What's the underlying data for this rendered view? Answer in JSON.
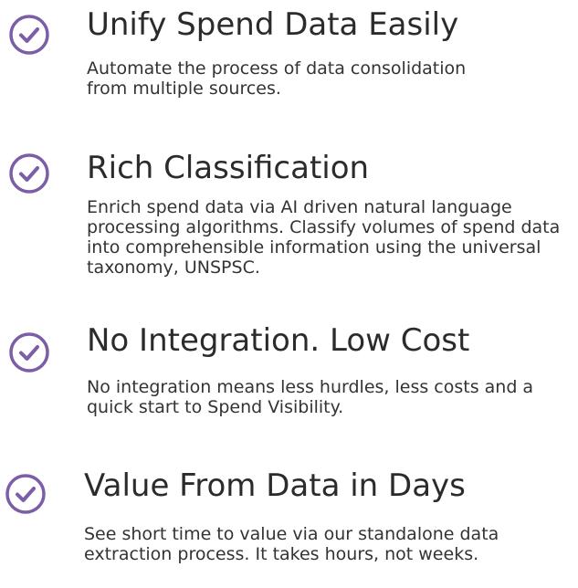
{
  "accent_color": "#7b5ea7",
  "features": [
    {
      "icon": "check-circle-icon",
      "title": "Unify Spend Data Easily",
      "description": "Automate the process of data consolidation from multiple sources."
    },
    {
      "icon": "check-circle-icon",
      "title": "Rich Classification",
      "description": "Enrich spend data via AI driven natural language processing algorithms. Classify volumes of spend data into comprehensible information using the universal taxonomy, UNSPSC."
    },
    {
      "icon": "check-circle-icon",
      "title": "No Integration. Low Cost",
      "description": "No integration means less hurdles, less costs and a quick start to Spend Visibility."
    },
    {
      "icon": "check-circle-icon",
      "title": "Value From Data in Days",
      "description": "See short time to value via our standalone data extraction process. It takes hours, not weeks."
    }
  ]
}
